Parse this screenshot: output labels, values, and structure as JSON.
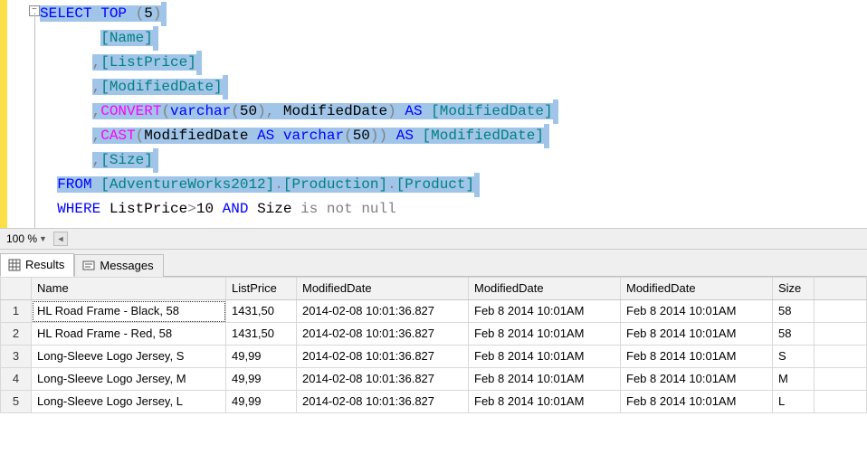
{
  "editor": {
    "lines": [
      {
        "indent": "",
        "segments": [
          {
            "t": "SELECT",
            "c": "kw-blue",
            "sel": true
          },
          {
            "t": " ",
            "c": "txt",
            "sel": true
          },
          {
            "t": "TOP",
            "c": "kw-blue",
            "sel": true
          },
          {
            "t": " ",
            "c": "txt",
            "sel": true
          },
          {
            "t": "(",
            "c": "kw-gray",
            "sel": true
          },
          {
            "t": "5",
            "c": "num",
            "sel": true
          },
          {
            "t": ")",
            "c": "kw-gray",
            "sel": true
          }
        ]
      },
      {
        "indent": "       ",
        "segments": [
          {
            "t": "[Name]",
            "c": "kw-teal",
            "sel": true
          }
        ]
      },
      {
        "indent": "      ",
        "segments": [
          {
            "t": ",",
            "c": "kw-gray",
            "sel": true
          },
          {
            "t": "[ListPrice]",
            "c": "kw-teal",
            "sel": true
          }
        ]
      },
      {
        "indent": "      ",
        "segments": [
          {
            "t": ",",
            "c": "kw-gray",
            "sel": true
          },
          {
            "t": "[ModifiedDate]",
            "c": "kw-teal",
            "sel": true
          }
        ]
      },
      {
        "indent": "      ",
        "segments": [
          {
            "t": ",",
            "c": "kw-gray",
            "sel": true
          },
          {
            "t": "CONVERT",
            "c": "kw-magenta",
            "sel": true
          },
          {
            "t": "(",
            "c": "kw-gray",
            "sel": true
          },
          {
            "t": "varchar",
            "c": "kw-blue",
            "sel": true
          },
          {
            "t": "(",
            "c": "kw-gray",
            "sel": true
          },
          {
            "t": "50",
            "c": "num",
            "sel": true
          },
          {
            "t": ")",
            "c": "kw-gray",
            "sel": true
          },
          {
            "t": ",",
            "c": "kw-gray",
            "sel": true
          },
          {
            "t": " ModifiedDate",
            "c": "txt",
            "sel": true
          },
          {
            "t": ")",
            "c": "kw-gray",
            "sel": true
          },
          {
            "t": " ",
            "c": "txt",
            "sel": true
          },
          {
            "t": "AS",
            "c": "kw-blue",
            "sel": true
          },
          {
            "t": " ",
            "c": "txt",
            "sel": true
          },
          {
            "t": "[ModifiedDate]",
            "c": "kw-teal",
            "sel": true
          }
        ]
      },
      {
        "indent": "      ",
        "segments": [
          {
            "t": ",",
            "c": "kw-gray",
            "sel": true
          },
          {
            "t": "CAST",
            "c": "kw-magenta",
            "sel": true
          },
          {
            "t": "(",
            "c": "kw-gray",
            "sel": true
          },
          {
            "t": "ModifiedDate ",
            "c": "txt",
            "sel": true
          },
          {
            "t": "AS",
            "c": "kw-blue",
            "sel": true
          },
          {
            "t": " ",
            "c": "txt",
            "sel": true
          },
          {
            "t": "varchar",
            "c": "kw-blue",
            "sel": true
          },
          {
            "t": "(",
            "c": "kw-gray",
            "sel": true
          },
          {
            "t": "50",
            "c": "num",
            "sel": true
          },
          {
            "t": "))",
            "c": "kw-gray",
            "sel": true
          },
          {
            "t": " ",
            "c": "txt",
            "sel": true
          },
          {
            "t": "AS",
            "c": "kw-blue",
            "sel": true
          },
          {
            "t": " ",
            "c": "txt",
            "sel": true
          },
          {
            "t": "[ModifiedDate]",
            "c": "kw-teal",
            "sel": true
          }
        ]
      },
      {
        "indent": "      ",
        "segments": [
          {
            "t": ",",
            "c": "kw-gray",
            "sel": true
          },
          {
            "t": "[Size]",
            "c": "kw-teal",
            "sel": true
          }
        ]
      },
      {
        "indent": "  ",
        "segments": [
          {
            "t": "FROM",
            "c": "kw-blue",
            "sel": true
          },
          {
            "t": " ",
            "c": "txt",
            "sel": true
          },
          {
            "t": "[AdventureWorks2012]",
            "c": "kw-teal",
            "sel": true
          },
          {
            "t": ".",
            "c": "kw-gray",
            "sel": true
          },
          {
            "t": "[Production]",
            "c": "kw-teal",
            "sel": true
          },
          {
            "t": ".",
            "c": "kw-gray",
            "sel": true
          },
          {
            "t": "[Product]",
            "c": "kw-teal",
            "sel": true
          }
        ]
      },
      {
        "indent": "  ",
        "segments": [
          {
            "t": "WHERE",
            "c": "kw-blue",
            "sel": false
          },
          {
            "t": " ListPrice",
            "c": "txt",
            "sel": false
          },
          {
            "t": ">",
            "c": "kw-gray",
            "sel": false
          },
          {
            "t": "10 ",
            "c": "num",
            "sel": false
          },
          {
            "t": "AND",
            "c": "kw-blue",
            "sel": false
          },
          {
            "t": " Size ",
            "c": "txt",
            "sel": false
          },
          {
            "t": "is",
            "c": "kw-gray",
            "sel": false
          },
          {
            "t": " ",
            "c": "txt",
            "sel": false
          },
          {
            "t": "not",
            "c": "kw-gray",
            "sel": false
          },
          {
            "t": " ",
            "c": "txt",
            "sel": false
          },
          {
            "t": "null",
            "c": "kw-gray",
            "sel": false
          }
        ]
      }
    ],
    "fold_toggle": "−"
  },
  "zoom": {
    "level": "100 %",
    "scroll_left": "◄"
  },
  "tabs": {
    "results_label": "Results",
    "messages_label": "Messages"
  },
  "grid": {
    "columns": [
      "Name",
      "ListPrice",
      "ModifiedDate",
      "ModifiedDate",
      "ModifiedDate",
      "Size"
    ],
    "rows": [
      {
        "n": "1",
        "Name": "HL Road Frame - Black, 58",
        "ListPrice": "1431,50",
        "d1": "2014-02-08 10:01:36.827",
        "d2": "Feb  8 2014 10:01AM",
        "d3": "Feb  8 2014 10:01AM",
        "Size": "58"
      },
      {
        "n": "2",
        "Name": "HL Road Frame - Red, 58",
        "ListPrice": "1431,50",
        "d1": "2014-02-08 10:01:36.827",
        "d2": "Feb  8 2014 10:01AM",
        "d3": "Feb  8 2014 10:01AM",
        "Size": "58"
      },
      {
        "n": "3",
        "Name": "Long-Sleeve Logo Jersey, S",
        "ListPrice": "49,99",
        "d1": "2014-02-08 10:01:36.827",
        "d2": "Feb  8 2014 10:01AM",
        "d3": "Feb  8 2014 10:01AM",
        "Size": "S"
      },
      {
        "n": "4",
        "Name": "Long-Sleeve Logo Jersey, M",
        "ListPrice": "49,99",
        "d1": "2014-02-08 10:01:36.827",
        "d2": "Feb  8 2014 10:01AM",
        "d3": "Feb  8 2014 10:01AM",
        "Size": "M"
      },
      {
        "n": "5",
        "Name": "Long-Sleeve Logo Jersey, L",
        "ListPrice": "49,99",
        "d1": "2014-02-08 10:01:36.827",
        "d2": "Feb  8 2014 10:01AM",
        "d3": "Feb  8 2014 10:01AM",
        "Size": "L"
      }
    ]
  }
}
